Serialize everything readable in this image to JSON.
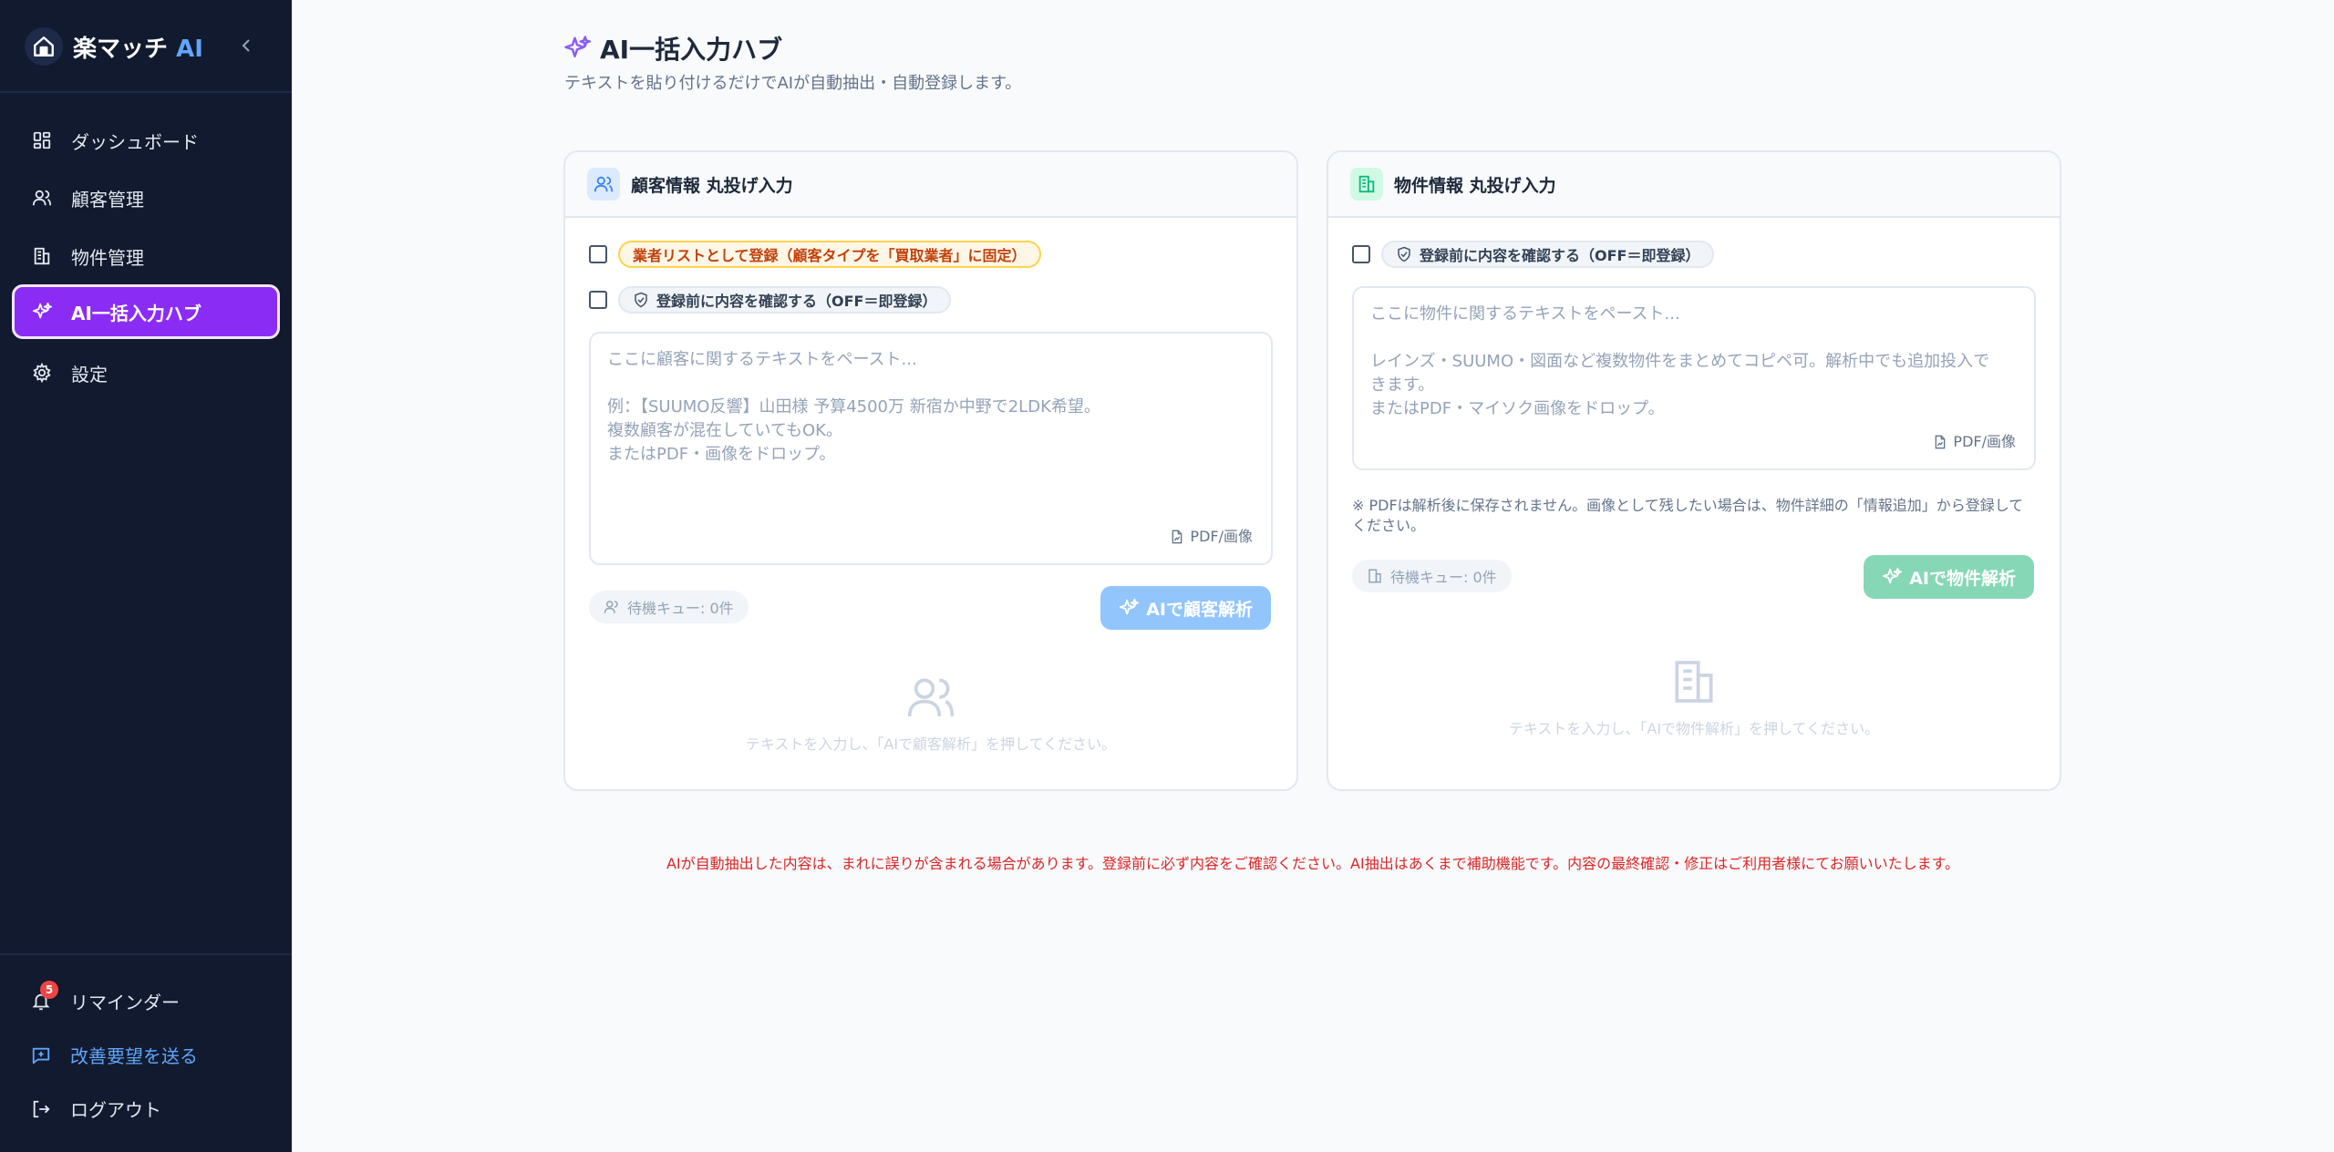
{
  "brand": {
    "name": "楽マッチ",
    "ai": "AI"
  },
  "nav": [
    {
      "label": "ダッシュボード",
      "icon": "dashboard-icon"
    },
    {
      "label": "顧客管理",
      "icon": "users-icon"
    },
    {
      "label": "物件管理",
      "icon": "building-icon"
    },
    {
      "label": "AI一括入力ハブ",
      "icon": "sparkles-icon",
      "active": true
    },
    {
      "label": "設定",
      "icon": "gear-icon"
    }
  ],
  "sidebar_bottom": {
    "reminder": {
      "label": "リマインダー",
      "badge": "5"
    },
    "feedback": {
      "label": "改善要望を送る"
    },
    "logout": {
      "label": "ログアウト"
    }
  },
  "page": {
    "title": "AI一括入力ハブ",
    "subtitle": "テキストを貼り付けるだけでAIが自動抽出・自動登録します。"
  },
  "customer_card": {
    "title": "顧客情報 丸投げ入力",
    "vendor_check_label": "業者リストとして登録（顧客タイプを「買取業者」に固定）",
    "confirm_check_label": "登録前に内容を確認する（OFF＝即登録）",
    "placeholder_lines": [
      "ここに顧客に関するテキストをペースト...",
      "",
      "例：【SUUMO反響】山田様 予算4500万 新宿か中野で2LDK希望。",
      "複数顧客が混在していてもOK。",
      "またはPDF・画像をドロップ。"
    ],
    "pdf_label": "PDF/画像",
    "queue_label": "待機キュー: 0件",
    "action_label": "AIで顧客解析",
    "empty_message": "テキストを入力し、「AIで顧客解析」を押してください。"
  },
  "property_card": {
    "title": "物件情報 丸投げ入力",
    "confirm_check_label": "登録前に内容を確認する（OFF＝即登録）",
    "placeholder_lines": [
      "ここに物件に関するテキストをペースト...",
      "",
      "レインズ・SUUMO・図面など複数物件をまとめてコピペ可。解析中でも追加投入で",
      "きます。",
      "またはPDF・マイソク画像をドロップ。"
    ],
    "pdf_label": "PDF/画像",
    "note": "※ PDFは解析後に保存されません。画像として残したい場合は、物件詳細の「情報追加」から登録してください。",
    "queue_label": "待機キュー: 0件",
    "action_label": "AIで物件解析",
    "empty_message": "テキストを入力し、「AIで物件解析」を押してください。"
  },
  "disclaimer": "AIが自動抽出した内容は、まれに誤りが含まれる場合があります。登録前に必ず内容をご確認ください。AI抽出はあくまで補助機能です。内容の最終確認・修正はご利用者様にてお願いいたします。",
  "colors": {
    "sidebar_bg": "#111a2e",
    "active_nav": "#8b2cf5",
    "accent_blue": "#60a5fa",
    "customer_button": "#93c5fd",
    "property_button": "#86d7b6",
    "warning_text": "#dc2626"
  }
}
